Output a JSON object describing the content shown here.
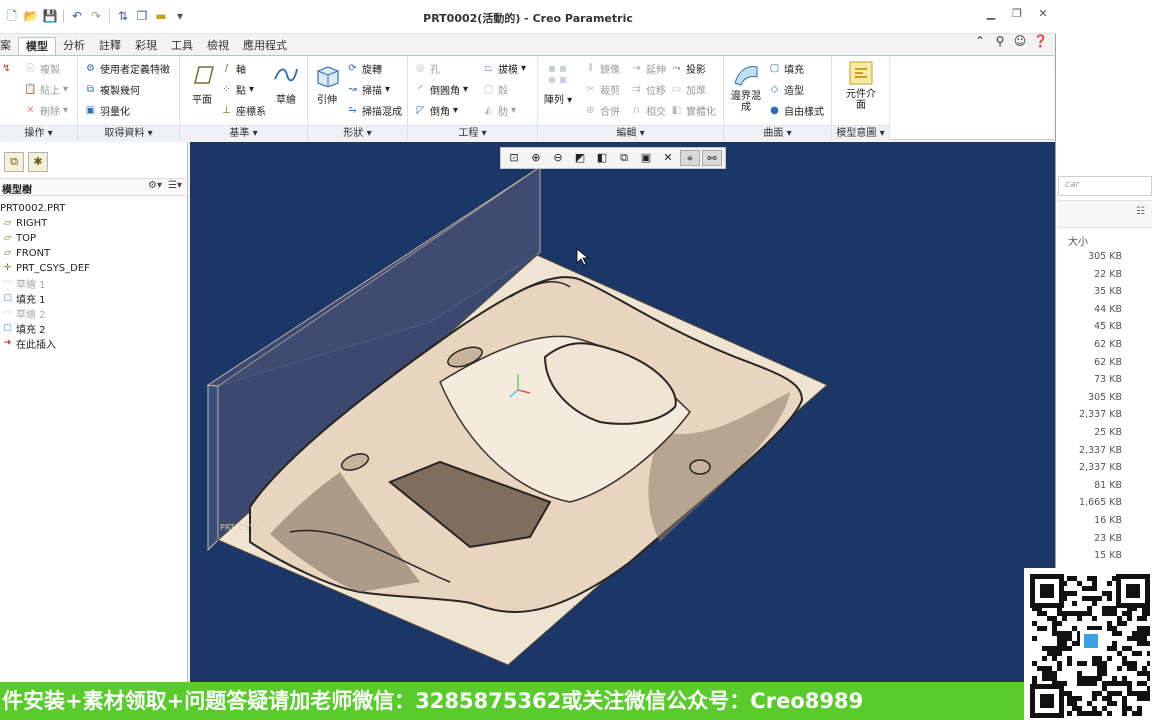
{
  "window": {
    "title": "PRT0002(活動的) - Creo Parametric",
    "controls": [
      "minimize",
      "restore",
      "close"
    ]
  },
  "quick_access": [
    "new-icon",
    "open-icon",
    "save-icon",
    "undo-icon",
    "redo-icon",
    "regenerate-icon",
    "windows-icon",
    "folder-icon",
    "more-icon"
  ],
  "tabs": [
    {
      "label": "案",
      "active": false
    },
    {
      "label": "模型",
      "active": true
    },
    {
      "label": "分析",
      "active": false
    },
    {
      "label": "註釋",
      "active": false
    },
    {
      "label": "彩現",
      "active": false
    },
    {
      "label": "工具",
      "active": false
    },
    {
      "label": "檢視",
      "active": false
    },
    {
      "label": "應用程式",
      "active": false
    }
  ],
  "ribbon": {
    "operations": {
      "footer": "操作",
      "items": [
        "複製",
        "貼上",
        "刪除"
      ]
    },
    "get_data": {
      "footer": "取得資料",
      "items": [
        "使用者定義特徵",
        "複製幾何",
        "羽量化"
      ]
    },
    "datum": {
      "footer": "基準",
      "big": "平面",
      "items": [
        "軸",
        "點",
        "座標系"
      ],
      "sketch": "草繪"
    },
    "shapes": {
      "footer": "形狀",
      "big": "引伸",
      "items": [
        "旋轉",
        "掃描",
        "掃描混成"
      ]
    },
    "engineering": {
      "footer": "工程",
      "items": [
        "孔",
        "倒圓角",
        "倒角",
        "拔模",
        "殼",
        "肋"
      ]
    },
    "editing": {
      "footer": "編輯",
      "pattern": "陣列",
      "items": [
        "鏡像",
        "延伸",
        "投影",
        "裁剪",
        "位移",
        "加厚",
        "合併",
        "相交",
        "實體化"
      ]
    },
    "surfaces": {
      "footer": "曲面",
      "big": "邊界混成",
      "items": [
        "填充",
        "造型",
        "自由樣式"
      ]
    },
    "model_intent": {
      "footer": "模型意圖",
      "big": "元件介面"
    }
  },
  "model_tree": {
    "header": "模型樹",
    "items": [
      {
        "label": "PRT0002.PRT",
        "icon": "part-icon",
        "suppressed": false
      },
      {
        "label": "RIGHT",
        "icon": "plane-icon",
        "suppressed": false
      },
      {
        "label": "TOP",
        "icon": "plane-icon",
        "suppressed": false
      },
      {
        "label": "FRONT",
        "icon": "plane-icon",
        "suppressed": false
      },
      {
        "label": "PRT_CSYS_DEF",
        "icon": "csys-icon",
        "suppressed": false
      },
      {
        "label": "草繪 1",
        "icon": "sketch-icon",
        "suppressed": true
      },
      {
        "label": "填充 1",
        "icon": "fill-icon",
        "suppressed": false
      },
      {
        "label": "草繪 2",
        "icon": "sketch-icon",
        "suppressed": true
      },
      {
        "label": "填充 2",
        "icon": "fill-icon",
        "suppressed": false
      },
      {
        "label": "在此插入",
        "icon": "insert-arrow-icon",
        "suppressed": false
      }
    ]
  },
  "viewport": {
    "background": "#1b3768",
    "csys_label": "PRT_CSYS",
    "toolbar": [
      "refit-icon",
      "zoom-in-icon",
      "zoom-out-icon",
      "repaint-icon",
      "display-style-icon",
      "saved-views-icon",
      "view-manager-icon",
      "datum-display-icon",
      "annotation-display-icon",
      "spin-center-icon"
    ]
  },
  "file_panel": {
    "search_placeholder": "car",
    "size_header": "大小",
    "sizes": [
      "305 KB",
      "22 KB",
      "35 KB",
      "44 KB",
      "45 KB",
      "62 KB",
      "62 KB",
      "73 KB",
      "305 KB",
      "2,337 KB",
      "25 KB",
      "2,337 KB",
      "2,337 KB",
      "81 KB",
      "1,665 KB",
      "16 KB",
      "23 KB",
      "15 KB"
    ]
  },
  "banner": {
    "text": "件安装+素材领取+问题答疑请加老师微信：3285875362或关注微信公众号：Creo8989",
    "color": "#59cc2c"
  }
}
